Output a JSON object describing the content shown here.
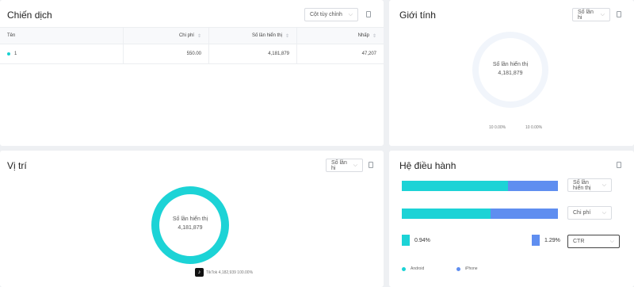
{
  "campaign": {
    "title": "Chiến dịch",
    "columns_button": "Cột tùy chỉnh",
    "headers": [
      "Tên",
      "Chi phí",
      "Số lần hiển thị",
      "Nhấp"
    ],
    "rows": [
      {
        "name": "1",
        "cost": "550.00",
        "impressions": "4,181,879",
        "clicks": "47,207"
      }
    ]
  },
  "gender": {
    "title": "Giới tính",
    "metric_select": "Số lần hi",
    "center_label": "Số lần hiển thị",
    "center_value": "4,181,879",
    "legend": [
      "10 0.00%",
      "10 0.00%"
    ]
  },
  "position": {
    "title": "Vị trí",
    "metric_select": "Số lần hi",
    "center_label": "Số lần hiển thị",
    "center_value": "4,181,879",
    "legend_item": "TikTok  4,182,939 100.00%"
  },
  "os": {
    "title": "Hệ điều hành",
    "row1_select": "Số lần hiển thị",
    "row2_select": "Chi phí",
    "row3_select": "CTR",
    "ctr_android": "0.94%",
    "ctr_iphone": "1.29%",
    "legend": [
      "Android",
      "iPhone"
    ],
    "colors": {
      "android": "#1cd3d6",
      "iphone": "#5f8ef0"
    },
    "impressions_android_share": 0.68,
    "cost_android_share": 0.57
  }
}
